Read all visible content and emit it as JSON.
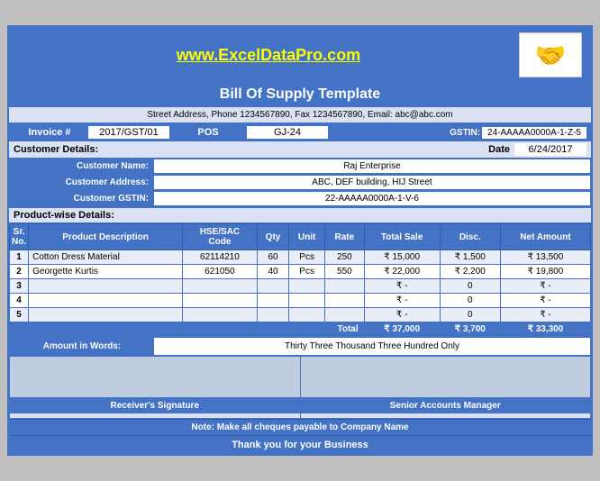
{
  "header": {
    "website": "www.ExcelDataPro.com",
    "bill_title": "Bill Of Supply Template",
    "address": "Street Address, Phone 1234567890, Fax 1234567890, Email: abc@abc.com"
  },
  "invoice": {
    "label": "Invoice #",
    "number": "2017/GST/01",
    "pos_label": "POS",
    "pos_value": "GJ-24",
    "gstin_label": "GSTIN:",
    "gstin_value": "24-AAAAA0000A-1-Z-5",
    "date_label": "Date",
    "date_value": "6/24/2017"
  },
  "customer": {
    "section_label": "Customer Details:",
    "name_label": "Customer Name:",
    "name_value": "Raj Enterprise",
    "address_label": "Customer Address:",
    "address_value": "ABC, DEF building, HIJ Street",
    "gstin_label": "Customer GSTIN:",
    "gstin_value": "22-AAAAA0000A-1-V-6"
  },
  "product_section_label": "Product-wise Details:",
  "table": {
    "headers": [
      "Sr. No.",
      "Product Description",
      "HSE/SAC Code",
      "Qty",
      "Unit",
      "Rate",
      "Total Sale",
      "Disc.",
      "Net Amount"
    ],
    "rows": [
      {
        "sr": "1",
        "desc": "Cotton Dress Material",
        "code": "62114210",
        "qty": "60",
        "unit": "Pcs",
        "rate": "250",
        "total_sale": "₹  15,000",
        "disc": "₹  1,500",
        "net": "₹  13,500"
      },
      {
        "sr": "2",
        "desc": "Georgette Kurtis",
        "code": "621050",
        "qty": "40",
        "unit": "Pcs",
        "rate": "550",
        "total_sale": "₹  22,000",
        "disc": "₹  2,200",
        "net": "₹  19,800"
      },
      {
        "sr": "3",
        "desc": "",
        "code": "",
        "qty": "",
        "unit": "",
        "rate": "",
        "total_sale": "₹         -",
        "disc": "0",
        "net": "₹         -"
      },
      {
        "sr": "4",
        "desc": "",
        "code": "",
        "qty": "",
        "unit": "",
        "rate": "",
        "total_sale": "₹         -",
        "disc": "0",
        "net": "₹         -"
      },
      {
        "sr": "5",
        "desc": "",
        "code": "",
        "qty": "",
        "unit": "",
        "rate": "",
        "total_sale": "₹         -",
        "disc": "0",
        "net": "₹         -"
      }
    ],
    "total_label": "Total",
    "total_sale": "₹  37,000",
    "total_disc": "₹  3,700",
    "total_net": "₹  33,300"
  },
  "amount_words": {
    "label": "Amount in Words:",
    "value": "Thirty Three Thousand Three Hundred Only"
  },
  "signatures": {
    "receiver": "Receiver's Signature",
    "senior": "Senior Accounts Manager"
  },
  "footer": {
    "note": "Note: Make all cheques payable to Company Name",
    "thankyou": "Thank you for your Business"
  }
}
